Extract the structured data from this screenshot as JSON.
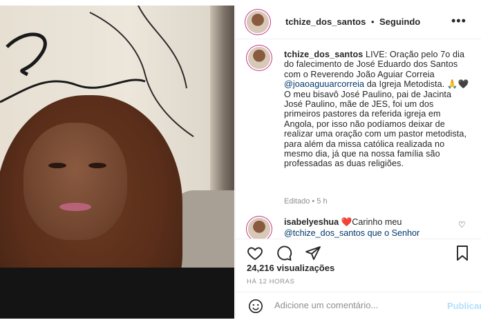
{
  "post": {
    "author": "tchize_dos_santos",
    "separator": "•",
    "follow_label": "Seguindo",
    "more_icon": "more-horizontal-icon"
  },
  "caption": {
    "user": "tchize_dos_santos",
    "text_part1": "LIVE: Oração pelo 7o dia do falecimento de José Eduardo dos Santos com o Reverendo João Aguiar Correia ",
    "mention": "@joaoaguuarcorreia",
    "text_part2": " da Igreja Metodista. 🙏🖤O meu bisavô José Paulino, pai de Jacinta José Paulino, mãe de JES, foi um dos primeiros pastores da referida igreja em Angola, por isso não podíamos deixar de realizar uma oração com um pastor metodista, para além da missa católica realizada no mesmo dia, já que na nossa família são professadas as duas religiões.",
    "meta": "Editado • 5 h"
  },
  "comment": {
    "user": "isabelyeshua",
    "heart": "❤️",
    "text": "Carinho meu",
    "mention_line": "@tchize_dos_santos que o Senhor"
  },
  "stats": {
    "views": "24,216 visualizações",
    "time": "HÁ 12 HORAS"
  },
  "composer": {
    "placeholder": "Adicione um comentário...",
    "publish_label": "Publicar"
  },
  "icons": [
    "like-heart-icon",
    "comment-icon",
    "share-icon",
    "save-bookmark-icon",
    "emoji-icon",
    "comment-like-icon"
  ],
  "colors": {
    "link": "#00376b",
    "heart_red": "#ed4956",
    "publish_disabled": "#b2dffc",
    "secondary_text": "#8e8e8e"
  }
}
